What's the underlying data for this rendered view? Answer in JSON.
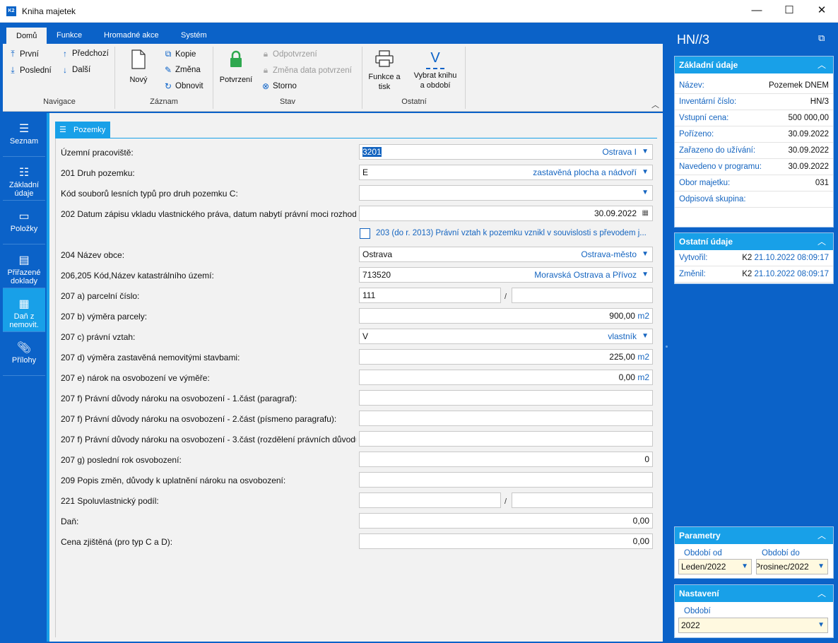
{
  "window": {
    "title": "Kniha majetek",
    "logo": "K2",
    "min": "—",
    "max": "☐",
    "close": "✕"
  },
  "ribbon": {
    "tabs": [
      "Domů",
      "Funkce",
      "Hromadné akce",
      "Systém"
    ],
    "active_tab": "Domů",
    "navigace": {
      "label": "Navigace",
      "prvni": "První",
      "posledni": "Poslední",
      "predchozi": "Předchozí",
      "dalsi": "Další"
    },
    "zaznam": {
      "label": "Záznam",
      "novy": "Nový",
      "kopie": "Kopie",
      "zmena": "Změna",
      "obnovit": "Obnovit"
    },
    "stav": {
      "label": "Stav",
      "potvrzeni": "Potvrzení",
      "odpotvrzeni": "Odpotvrzení",
      "zmena_data": "Změna data potvrzení",
      "storno": "Storno"
    },
    "ostatni": {
      "label": "Ostatní",
      "funkce_tisk_1": "Funkce a",
      "funkce_tisk_2": "tisk",
      "vybrat_1": "Vybrat knihu",
      "vybrat_2": "a období",
      "vybrat_icon_text": "V"
    }
  },
  "nav": {
    "seznam": "Seznam",
    "zakladni_1": "Základní",
    "zakladni_2": "údaje",
    "polozky": "Položky",
    "prirazene_1": "Přiřazené",
    "prirazene_2": "doklady",
    "dan_1": "Daň z",
    "dan_2": "nemovit.",
    "prilohy": "Přílohy",
    "active": "dan"
  },
  "form": {
    "tab": "Pozemky",
    "uzemni": {
      "label": "Územní pracoviště:",
      "code": "3201",
      "text": "Ostrava I"
    },
    "druh": {
      "label": "201 Druh pozemku:",
      "code": "E",
      "text": "zastavěná plocha a nádvoří"
    },
    "kod_lesnich": {
      "label": "Kód souborů lesních typů pro druh pozemku C:"
    },
    "datum_zapisu": {
      "label": "202 Datum zápisu vkladu vlastnického práva, datum nabytí právní moci rozhodn",
      "value": "30.09.2022"
    },
    "check_203": "203 (do r. 2013) Právní vztah k pozemku vznikl v souvislosti s převodem j...",
    "obec": {
      "label": "204 Název obce:",
      "code": "Ostrava",
      "text": "Ostrava-město"
    },
    "katastr": {
      "label": "206,205 Kód,Název katastrálního území:",
      "code": "713520",
      "text": "Moravská Ostrava a Přívoz"
    },
    "parcelni": {
      "label": "207 a) parcelní číslo:",
      "value1": "111",
      "value2": "",
      "sep": "/"
    },
    "vymera": {
      "label": "207 b) výměra parcely:",
      "value": "900,00",
      "unit": "m2"
    },
    "pravni_vztah": {
      "label": "207 c) právní vztah:",
      "code": "V",
      "text": "vlastník"
    },
    "vymera_zast": {
      "label": "207 d) výměra zastavěná nemovitými stavbami:",
      "value": "225,00",
      "unit": "m2"
    },
    "narok": {
      "label": "207 e) nárok na osvobození ve výměře:",
      "value": "0,00",
      "unit": "m2"
    },
    "duvody1": {
      "label": "207 f) Právní důvody nároku na osvobození - 1.část (paragraf):"
    },
    "duvody2": {
      "label": "207 f) Právní důvody nároku na osvobození - 2.část (písmeno paragrafu):"
    },
    "duvody3": {
      "label": "207 f) Právní důvody nároku na osvobození - 3.část (rozdělení právních důvodů"
    },
    "posledni_rok": {
      "label": "207 g) poslední rok osvobození:",
      "value": "0"
    },
    "popis_zmen": {
      "label": "209 Popis změn, důvody k uplatnění nároku na osvobození:"
    },
    "podil": {
      "label": "221 Spoluvlastnický podíl:",
      "sep": "/"
    },
    "dan": {
      "label": "Daň:",
      "value": "0,00"
    },
    "cena": {
      "label": "Cena zjištěná (pro typ C a D):",
      "value": "0,00"
    }
  },
  "right": {
    "title": "HN//3",
    "zakladni": {
      "header": "Základní údaje",
      "rows": [
        {
          "label": "Název:",
          "value": "Pozemek DNEM"
        },
        {
          "label": "Inventární číslo:",
          "value": "HN/3"
        },
        {
          "label": "Vstupní cena:",
          "value": "500 000,00"
        },
        {
          "label": "Pořízeno:",
          "value": "30.09.2022"
        },
        {
          "label": "Zařazeno do užívání:",
          "value": "30.09.2022"
        },
        {
          "label": "Navedeno v programu:",
          "value": "30.09.2022"
        },
        {
          "label": "Obor majetku:",
          "value": "031"
        },
        {
          "label": "Odpisová skupina:",
          "value": ""
        }
      ]
    },
    "ostatni": {
      "header": "Ostatní údaje",
      "vytvoril": {
        "label": "Vytvořil:",
        "user": "K2",
        "date": "21.10.2022 08:09:17"
      },
      "zmenil": {
        "label": "Změnil:",
        "user": "K2",
        "date": "21.10.2022 08:09:17"
      }
    },
    "parametry": {
      "header": "Parametry",
      "od_label": "Období od",
      "od_value": "Leden/2022",
      "do_label": "Období do",
      "do_value": "Prosinec/2022"
    },
    "nastaveni": {
      "header": "Nastavení",
      "obdobi_label": "Období",
      "obdobi_value": "2022"
    }
  }
}
